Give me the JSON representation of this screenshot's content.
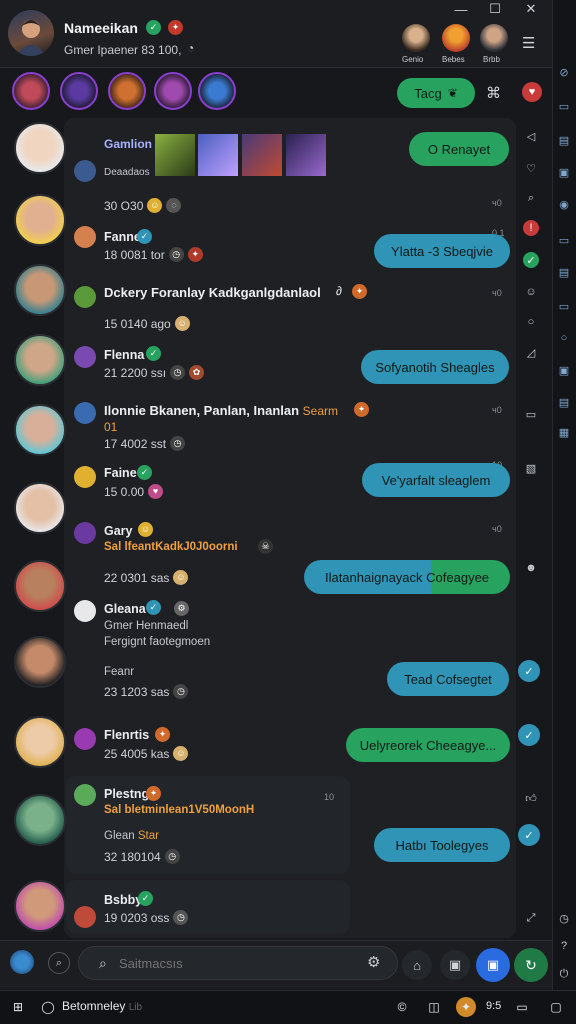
{
  "header": {
    "title": "Nameeikan",
    "subtitle": "Gmer Ipaener 83 100,",
    "top_avatars": [
      {
        "label": "Genio"
      },
      {
        "label": "Bebes"
      },
      {
        "label": "Brbb"
      }
    ]
  },
  "toolbar": {
    "tag_label": "Tacg"
  },
  "gallery": {
    "title": "Gamlion",
    "subtitle": "Deaadaos"
  },
  "rows": [
    {
      "meta": "30 O30"
    },
    {
      "name": "Fanne",
      "meta": "18 0081 tor"
    },
    {
      "name": "Dckery Foranlay Kadkganlgdanlaol",
      "meta": "15 0140 ago"
    },
    {
      "name": "Flenna",
      "meta": "21 2200 ssı"
    },
    {
      "name": "Ilonnie Bkanen, Panlan, Inanlan",
      "name_extra": "Searm",
      "name_line2": "01",
      "meta": "17 4002 sst"
    },
    {
      "name": "Faine",
      "meta": "15 0.00"
    },
    {
      "name": "Gary",
      "sub": "Sal lfeantKadkJ0J0oorni",
      "meta": "22 0301 sas"
    },
    {
      "name": "Gleana",
      "sub": "Gmer Henmaedl",
      "sub2": "Fergignt faotegmoen",
      "meta_label": "Feanr",
      "meta": "23 1203 sas"
    },
    {
      "name": "Flenrtis",
      "meta": "25 4005 kas"
    },
    {
      "name": "Plestng",
      "sub": "Sal bletminlean1V50MoonH",
      "sub2": "Glean",
      "sub2b": "Star",
      "meta": "32 180104"
    },
    {
      "name": "Bsbby",
      "meta": "19 0203 oss"
    }
  ],
  "bubbles": [
    {
      "text": "O Renayet"
    },
    {
      "text": "Ylatta -3 Sbeqjvie"
    },
    {
      "text": "Sofyanotih Sheagles"
    },
    {
      "text": "Ve'yarfalt sleaglem"
    },
    {
      "text": "Ilatanhaignayack Cofeagyee"
    },
    {
      "text": "Tead Cofsegtet"
    },
    {
      "text": "Uelyreorek Cheeagye..."
    },
    {
      "text": "Hatbı Toolegyes"
    }
  ],
  "timers": [
    "ч0",
    "ч0",
    "ч0",
    "ч0",
    "10",
    "0.1",
    "10"
  ],
  "composer": {
    "placeholder": "Saitmacsıs"
  },
  "taskbar": {
    "app_label": "Betomneley",
    "app_suffix": "Lib",
    "clock": "9:5"
  },
  "colors": {
    "accent_green": "#27a25f",
    "accent_blue": "#2f94b5",
    "background": "#16181c",
    "panel": "#1e2024"
  }
}
